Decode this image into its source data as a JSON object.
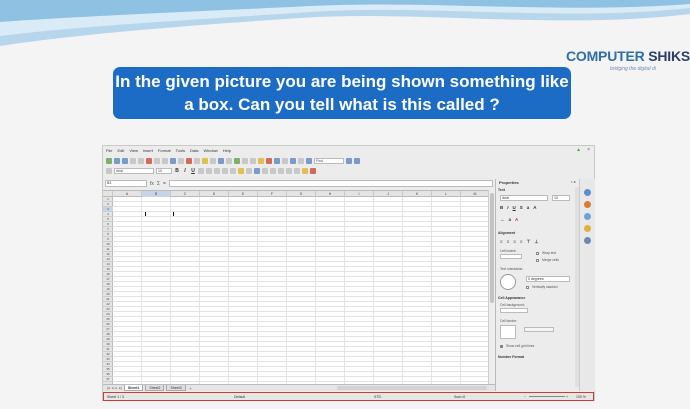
{
  "slide": {
    "question": "In the given picture you are being shown something like a box. Can you tell what is this called ?",
    "logo_main_a": "COMPUTER",
    "logo_main_b": "SHIKSH",
    "logo_tag": "bridging the digital di"
  },
  "app": {
    "menu": [
      "File",
      "Edit",
      "View",
      "Insert",
      "Format",
      "Tools",
      "Data",
      "Window",
      "Help"
    ],
    "font_name": "Arial",
    "font_size": "10",
    "find_placeholder": "Find",
    "name_box": "B3",
    "fx_label": "fx",
    "sum_label": "Σ",
    "equals_label": "=",
    "columns": [
      "A",
      "B",
      "C",
      "D",
      "E",
      "F",
      "G",
      "H",
      "I",
      "J",
      "K",
      "L",
      "M"
    ],
    "rows": [
      "1",
      "2",
      "3",
      "4",
      "5",
      "6",
      "7",
      "8",
      "9",
      "10",
      "11",
      "12",
      "13",
      "14",
      "15",
      "16",
      "17",
      "18",
      "19",
      "20",
      "21",
      "22",
      "23",
      "24",
      "25",
      "26",
      "27",
      "28",
      "29",
      "30",
      "31",
      "32",
      "33",
      "34",
      "35",
      "36",
      "37"
    ],
    "sheet_tabs": [
      "Sheet1",
      "Sheet2",
      "Sheet3"
    ],
    "add_tab": "+"
  },
  "sidebar": {
    "title": "Properties",
    "text_section": "Text",
    "sidebar_font": "Arial",
    "sidebar_size": "10",
    "alignment_section": "Alignment",
    "left_indent": "Left indent:",
    "wrap_text": "Wrap text",
    "merge_cells": "Merge cells",
    "text_orientation": "Text orientation:",
    "degrees": "0 degrees",
    "vertically_stacked": "Vertically stacked",
    "cell_appearance": "Cell Appearance",
    "cell_background": "Cell background:",
    "cell_border": "Cell border:",
    "show_grid": "Show cell grid lines",
    "number_format": "Number Format"
  },
  "status": {
    "sheet_pos": "Sheet 1 / 3",
    "style": "Default",
    "lang": "STD",
    "sum": "Sum=0",
    "zoom": "100 %"
  },
  "colors": {
    "question_bg": "#1c6cc6",
    "status_highlight": "#d23a3a",
    "selection": "#c6d4e8"
  }
}
